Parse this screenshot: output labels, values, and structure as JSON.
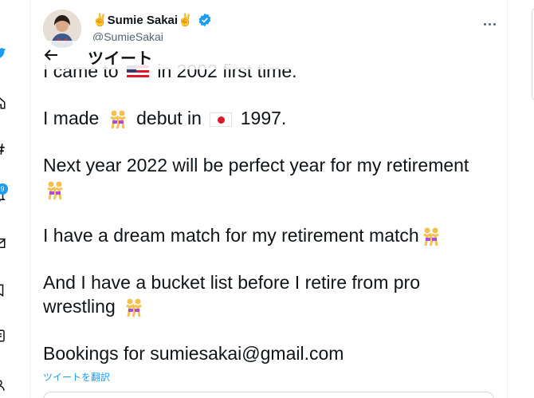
{
  "nav": {
    "notifications_badge": "9"
  },
  "author": {
    "name": "✌️Sumie Sakai✌️",
    "handle": "@SumieSakai"
  },
  "header": {
    "title": "ツイート"
  },
  "tweet": {
    "line1_pre": "I came to",
    "line1_post": "in 2002 first time.",
    "line2_pre": "I made",
    "line2_mid": "debut in",
    "line2_post": "1997.",
    "line3": "Next year 2022 will be perfect year for my retirement",
    "line4": "I have a dream match for my retirement match",
    "line5a": "And I have a bucket list before I retire from pro",
    "line5b": "wrestling",
    "line6": "Bookings for sumiesakai@gmail.com"
  },
  "translate_link": "ツイートを翻訳",
  "colors": {
    "accent": "#1d9bf0",
    "text": "#0f1419",
    "muted": "#536471"
  },
  "icons": [
    "twitter-logo-icon",
    "home-icon",
    "explore-icon",
    "notifications-icon",
    "messages-icon",
    "bookmarks-icon",
    "lists-icon",
    "profile-icon",
    "verified-badge-icon",
    "more-dots-icon",
    "back-arrow-icon",
    "wrestlers-emoji-icon",
    "us-flag-icon",
    "japan-flag-icon"
  ]
}
